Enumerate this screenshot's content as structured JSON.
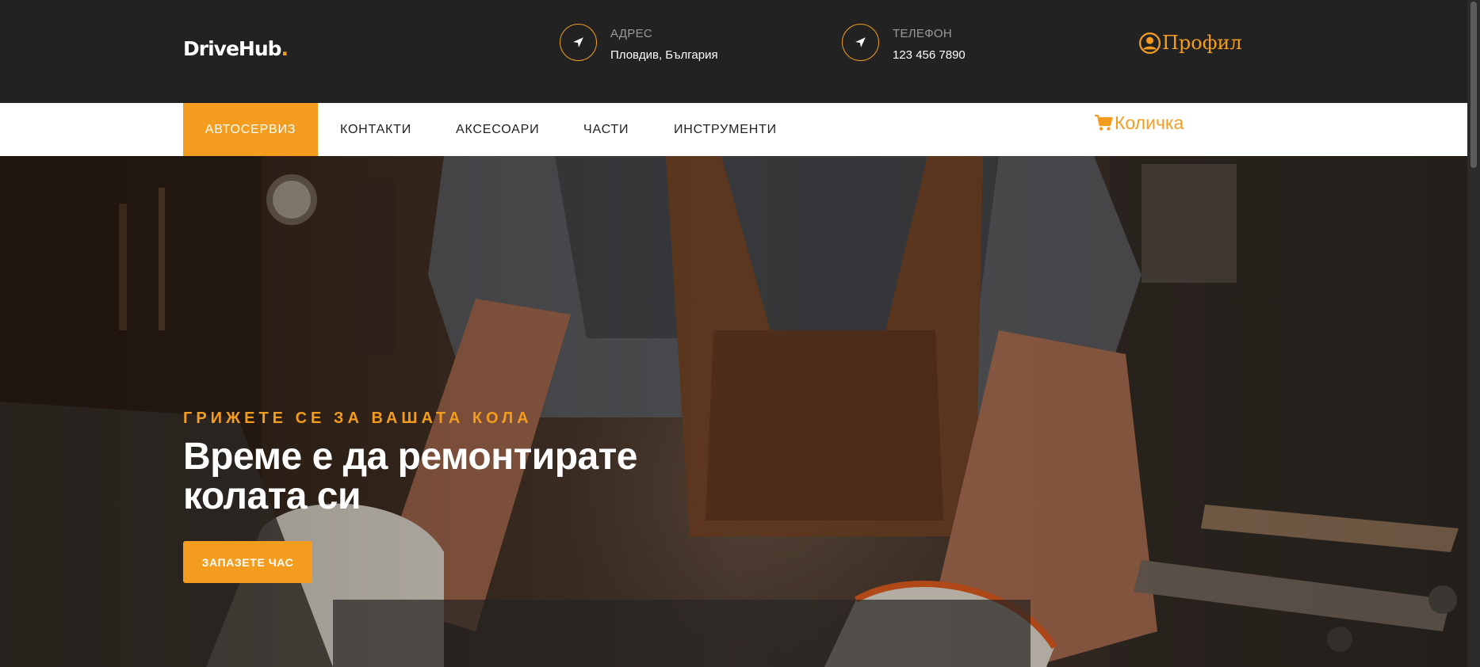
{
  "brand": {
    "name": "DriveHub",
    "dot": "."
  },
  "header": {
    "address": {
      "label": "АДРЕС",
      "value": "Пловдив, България",
      "icon": "location-arrow-icon"
    },
    "phone": {
      "label": "ТЕЛЕФОН",
      "value": "123 456 7890",
      "icon": "location-arrow-icon"
    },
    "profile": {
      "label": "Профил",
      "icon": "user-circle-icon"
    }
  },
  "nav": {
    "items": [
      "АВТОСЕРВИЗ",
      "КОНТАКТИ",
      "АКСЕСОАРИ",
      "ЧАСТИ",
      "ИНСТРУМЕНТИ"
    ],
    "cart": {
      "label": "Количка",
      "icon": "shopping-cart-icon"
    }
  },
  "hero": {
    "eyebrow": "ГРИЖЕТЕ СЕ ЗА ВАШАТА КОЛА",
    "title": "Време е да ремонтирате колата си",
    "cta": "ЗАПАЗЕТЕ ЧАС"
  },
  "colors": {
    "accent": "#f39c1e",
    "topbar": "#222222",
    "nav": "#ffffff"
  }
}
